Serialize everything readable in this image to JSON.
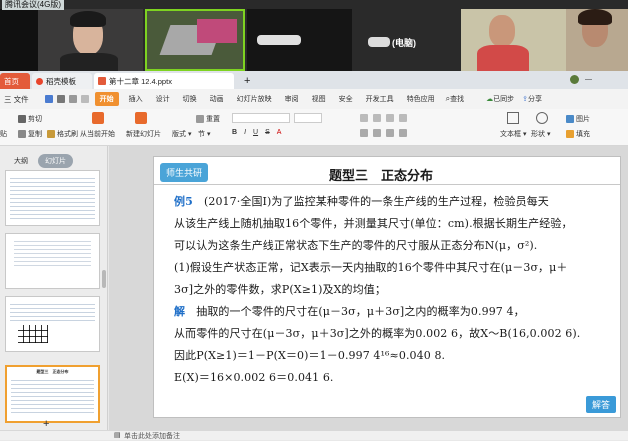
{
  "meeting": {
    "title": "腾讯会议(4G版)",
    "participant_label": "(电脑)"
  },
  "tabs": {
    "home": "首页",
    "template": "稻壳模板",
    "file": "第十二章 12.4.pptx",
    "add": "+"
  },
  "menu": {
    "file": "三 文件",
    "items": [
      "开始",
      "插入",
      "设计",
      "切换",
      "动画",
      "幻灯片放映",
      "审阅",
      "视图",
      "安全",
      "开发工具",
      "特色应用"
    ],
    "search": "查找",
    "sync": "已同步",
    "share": "分享"
  },
  "toolbar": {
    "cut": "剪切",
    "copy": "复制",
    "painter": "格式刷",
    "paste": "贴",
    "play": "从当前开始",
    "new_slide": "新建幻灯片",
    "layout": "版式",
    "section": "节",
    "reset": "重置",
    "bold": "B",
    "italic": "I",
    "underline": "U",
    "strike": "S",
    "textbox": "文本框",
    "shape": "形状",
    "image": "图片",
    "fill": "填充"
  },
  "panel": {
    "outline": "大纲",
    "slides": "幻灯片",
    "thumb_heading": "题型三　正态分布",
    "add": "+"
  },
  "slide": {
    "badge": "师生共研",
    "title": "题型三　正态分布",
    "example_label": "例5",
    "line1": "(2017·全国Ⅰ)为了监控某种零件的一条生产线的生产过程，检验员每天",
    "line2": "从该生产线上随机抽取16个零件，并测量其尺寸(单位：cm).根据长期生产经验，",
    "line3": "可以认为这条生产线正常状态下生产的零件的尺寸服从正态分布N(μ，σ²).",
    "line4": "(1)假设生产状态正常，记X表示一天内抽取的16个零件中其尺寸在(μ－3σ，μ＋",
    "line5": "3σ]之外的零件数，求P(X≥1)及X的均值；",
    "solve_label": "解",
    "line6": "抽取的一个零件的尺寸在(μ－3σ，μ＋3σ]之内的概率为0.997 4，",
    "line7": "从而零件的尺寸在(μ－3σ，μ＋3σ]之外的概率为0.002 6，故X～B(16,0.002 6).",
    "line8": "因此P(X≥1)＝1－P(X＝0)＝1－0.997 4¹⁶≈0.040 8.",
    "line9": "E(X)＝16×0.002 6＝0.041 6.",
    "answer_button": "解答"
  },
  "status": {
    "note": "单击此处添加备注"
  }
}
